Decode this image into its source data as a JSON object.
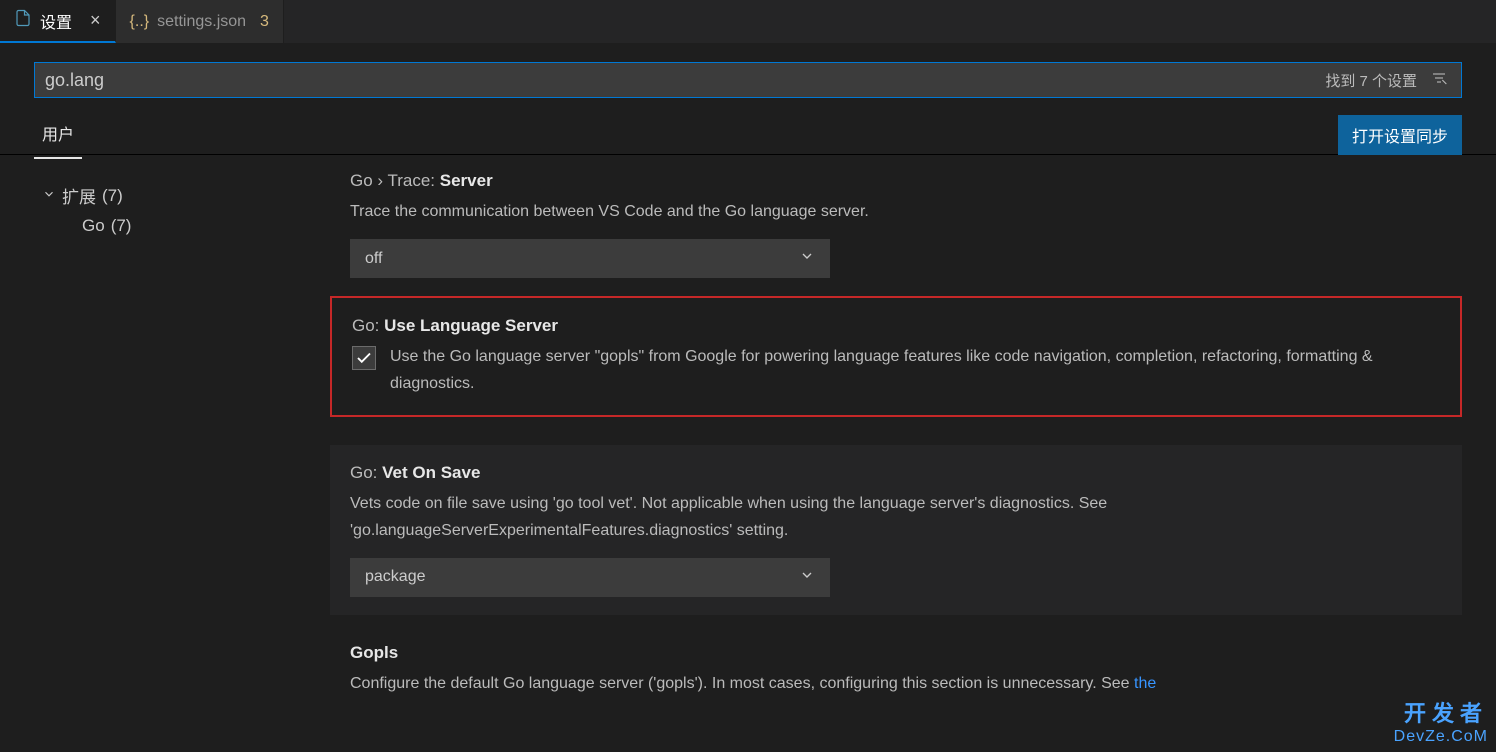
{
  "tabs": [
    {
      "label": "设置",
      "kind": "settings",
      "active": true
    },
    {
      "label": "settings.json",
      "kind": "json",
      "badge": "3",
      "active": false
    }
  ],
  "search": {
    "value": "go.lang",
    "result_text": "找到 7 个设置"
  },
  "scope": {
    "user_label": "用户"
  },
  "sync_button": "打开设置同步",
  "sidebar": {
    "root": {
      "label": "扩展",
      "count": "(7)"
    },
    "child": {
      "label": "Go",
      "count": "(7)"
    }
  },
  "settings": {
    "trace": {
      "prefix": "Go › Trace: ",
      "name": "Server",
      "desc": "Trace the communication between VS Code and the Go language server.",
      "value": "off"
    },
    "useLang": {
      "prefix": "Go: ",
      "name": "Use Language Server",
      "desc": "Use the Go language server \"gopls\" from Google for powering language features like code navigation, completion, refactoring, formatting & diagnostics."
    },
    "vetOnSave": {
      "prefix": "Go: ",
      "name": "Vet On Save",
      "desc": "Vets code on file save using 'go tool vet'. Not applicable when using the language server's diagnostics. See 'go.languageServerExperimentalFeatures.diagnostics' setting.",
      "value": "package"
    },
    "gopls": {
      "name": "Gopls",
      "desc_a": "Configure the default Go language server ('gopls'). In most cases, configuring this section is unnecessary. See ",
      "link": "the"
    }
  },
  "watermark": {
    "line1": "开发者",
    "line2": "DevZe.CoM"
  }
}
